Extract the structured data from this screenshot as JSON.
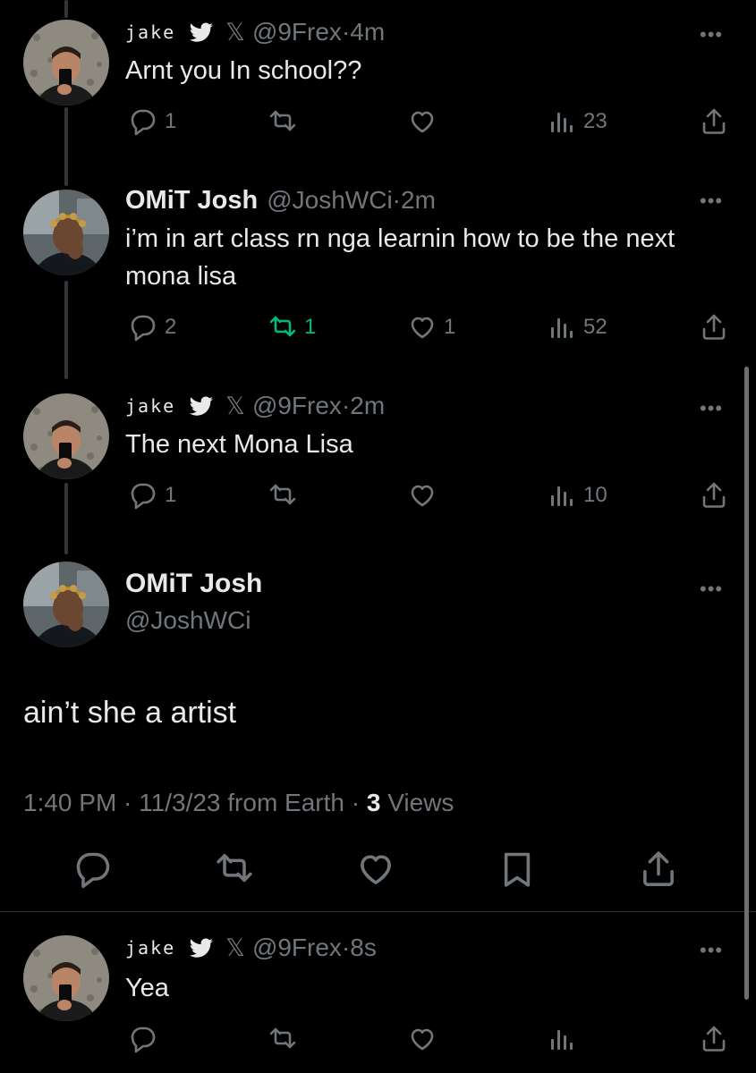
{
  "tweets": [
    {
      "display_name": "jake",
      "handle": "@9Frex",
      "x_label": "𝕏",
      "time": "·4m",
      "text": "Arnt you In school??",
      "replies": "1",
      "retweets": "",
      "likes": "",
      "views": "23"
    },
    {
      "display_name": "OMiT Josh",
      "handle": "@JoshWCi",
      "time": "·2m",
      "text": "i’m in art class rn nga learnin how to be the next mona lisa",
      "replies": "2",
      "retweets": "1",
      "likes": "1",
      "views": "52"
    },
    {
      "display_name": "jake",
      "handle": "@9Frex",
      "x_label": "𝕏",
      "time": "·2m",
      "text": "The next Mona Lisa",
      "replies": "1",
      "retweets": "",
      "likes": "",
      "views": "10"
    }
  ],
  "main_tweet": {
    "display_name": "OMiT Josh",
    "handle": "@JoshWCi",
    "text": "ain’t she a artist",
    "time": "1:40 PM · 11/3/23 from Earth ·",
    "views_count": "3",
    "views_label": "Views"
  },
  "reply": {
    "display_name": "jake",
    "handle": "@9Frex",
    "x_label": "𝕏",
    "time": "·8s",
    "text": "Yea"
  },
  "more_label": "•••",
  "colors": {
    "background": "#000000",
    "text": "#e7e9ea",
    "muted": "#71767b",
    "retweet_active": "#00ba7c",
    "bird_blue": "#1d9bf0"
  }
}
